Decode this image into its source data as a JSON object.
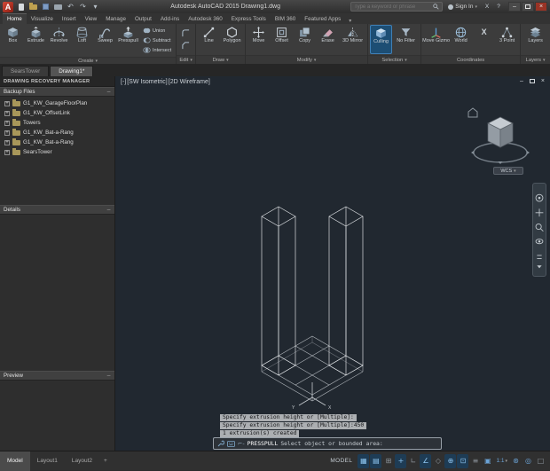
{
  "titlebar": {
    "title": "Autodesk AutoCAD 2015  Drawing1.dwg",
    "search_placeholder": "Type a keyword or phrase",
    "signin_label": "Sign In"
  },
  "icons": {
    "undo": "↶",
    "redo": "↷",
    "chevron_down": "▾",
    "minimize": "–",
    "close": "×",
    "help": "?",
    "exchange": "X",
    "collapse": "−",
    "prompt_prefix": "⌐-"
  },
  "ribbon": {
    "tabs": [
      "Home",
      "Visualize",
      "Insert",
      "View",
      "Manage",
      "Output",
      "Add-ins",
      "Autodesk 360",
      "Express Tools",
      "BIM 360",
      "Featured Apps"
    ],
    "panels": {
      "create": {
        "label": "Create",
        "tools": [
          "Box",
          "Extrude",
          "Revolve",
          "Loft",
          "Sweep",
          "Presspull"
        ],
        "bool_tools": [
          "Union",
          "Subtract",
          "Intersect"
        ]
      },
      "edit": {
        "label": "Edit"
      },
      "draw": {
        "label": "Draw",
        "tools": [
          "Line",
          "Polygon"
        ]
      },
      "modify": {
        "label": "Modify",
        "tools": [
          "Move",
          "Offset",
          "Copy",
          "Erase",
          "3D Mirror"
        ]
      },
      "selection": {
        "label": "Selection",
        "tools": [
          "Culling",
          "No Filter"
        ]
      },
      "coordinates": {
        "label": "Coordinates",
        "tools": [
          "Move Gizmo",
          "World",
          "X",
          "3 Point"
        ]
      },
      "layers": {
        "label": "Layers",
        "tools": [
          "Layers"
        ]
      }
    }
  },
  "file_tabs": [
    "SearsTower",
    "Drawing1*"
  ],
  "palette": {
    "title": "DRAWING RECOVERY MANAGER",
    "backup_header": "Backup Files",
    "items": [
      "G1_KW_GarageFloorPlan",
      "G1_KW_OffsetLink",
      "Towers",
      "G1_KW_Bat-a-Rang",
      "G1_KW_Bat-a-Rang",
      "SearsTower"
    ],
    "details_header": "Details",
    "preview_header": "Preview"
  },
  "viewport": {
    "controls": [
      "[-]",
      "[SW Isometric]",
      "[2D Wireframe]"
    ],
    "viewcube_label": "WCS",
    "ucs_x": "X",
    "ucs_y": "Y"
  },
  "command": {
    "history": [
      "Specify extrusion height or [Multiple]:",
      "Specify extrusion height or [Multiple]:450",
      "1 extrusion(s) created"
    ],
    "prompt_command": "PRESSPULL",
    "prompt_text": "Select object or bounded area:"
  },
  "statusbar": {
    "layout_tabs": [
      "Model",
      "Layout1",
      "Layout2"
    ],
    "new_layout_label": "+",
    "model_label": "MODEL",
    "annotation_scale": "1:1",
    "icons": {
      "grid": "▦",
      "snap": "▤",
      "infer": "⊞",
      "dynamic_input": "+",
      "ortho": "∟",
      "polar": "∠",
      "isodraft": "◇",
      "osnap_tracking": "⊕",
      "osnap": "⊡",
      "lineweight": "≡",
      "selection_cycling": "▣",
      "gear": "⊛",
      "annotation_monitor": "◎",
      "clean_screen": "□"
    }
  }
}
